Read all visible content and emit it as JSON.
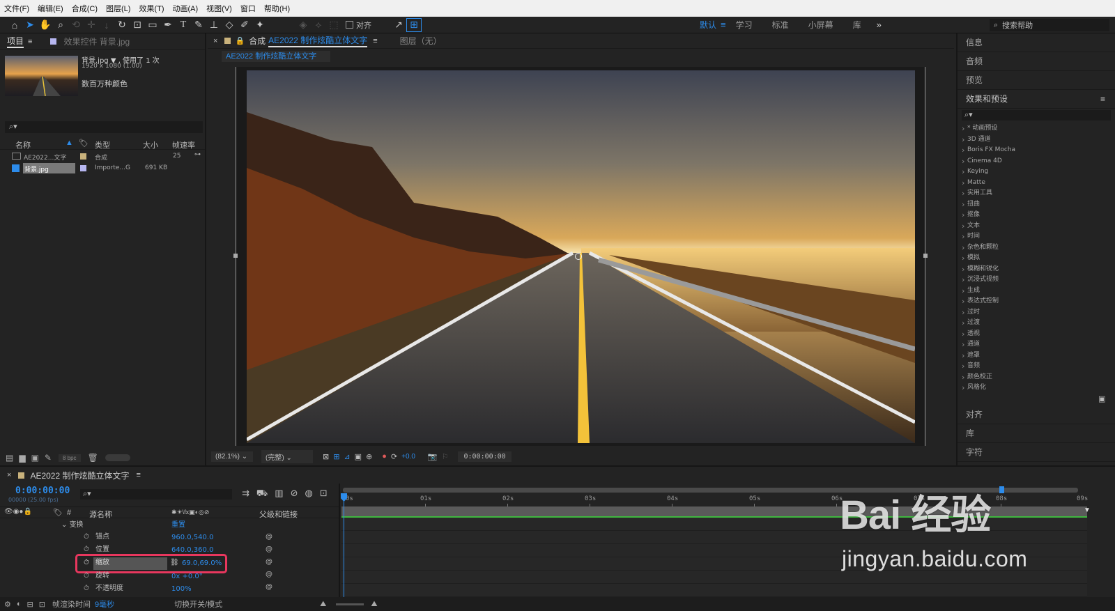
{
  "menu": [
    "文件(F)",
    "编辑(E)",
    "合成(C)",
    "图层(L)",
    "效果(T)",
    "动画(A)",
    "视图(V)",
    "窗口",
    "帮助(H)"
  ],
  "toolbar": {
    "align_label": "对齐",
    "workspaces": [
      "默认",
      "学习",
      "标准",
      "小屏幕",
      "库"
    ],
    "active_workspace": "默认",
    "search_placeholder": "搜索帮助"
  },
  "project": {
    "tab_project": "项目",
    "tab_effects": "效果控件 背景.jpg",
    "asset_name": "背景.jpg ▼ , 使用了 1 次",
    "asset_dims": "1920 x 1080 (1.00)",
    "asset_colors": "数百万种颜色",
    "columns": [
      "名称",
      "类型",
      "大小",
      "帧速率"
    ],
    "items": [
      {
        "name": "AE2022...文字",
        "type": "合成",
        "size": "",
        "fps": "25"
      },
      {
        "name": "背景.jpg",
        "type": "Importe...G",
        "size": "691 KB",
        "fps": ""
      }
    ],
    "bpc": "8 bpc"
  },
  "comp": {
    "tab_prefix": "合成",
    "comp_name": "AE2022 制作炫酷立体文字",
    "layer_tab": "图层（无）",
    "subtab": "AE2022 制作炫酷立体文字",
    "zoom": "(82.1%)",
    "resolution": "(完整)",
    "exposure": "+0.0",
    "timecode": "0:00:00:00"
  },
  "right_panel": {
    "sections_top": [
      "信息",
      "音频",
      "预览"
    ],
    "effects_title": "效果和预设",
    "effects": [
      "* 动画预设",
      "3D 通道",
      "Boris FX Mocha",
      "Cinema 4D",
      "Keying",
      "Matte",
      "实用工具",
      "扭曲",
      "抠像",
      "文本",
      "时间",
      "杂色和颗粒",
      "模拟",
      "模糊和锐化",
      "沉浸式视频",
      "生成",
      "表达式控制",
      "过时",
      "过渡",
      "透视",
      "通道",
      "遮罩",
      "音频",
      "颜色校正",
      "风格化"
    ],
    "sections_bottom": [
      "对齐",
      "库",
      "字符"
    ]
  },
  "timeline": {
    "comp_name": "AE2022 制作炫酷立体文字",
    "timecode": "0:00:00:00",
    "fps_note": "00000 (25.00 fps)",
    "col_source": "源名称",
    "col_parent": "父级和链接",
    "transform_label": "变换",
    "reset_label": "重置",
    "props": [
      {
        "name": "锚点",
        "value": "960.0,540.0"
      },
      {
        "name": "位置",
        "value": "640.0,360.0"
      },
      {
        "name": "缩放",
        "value": "69.0,69.0%"
      },
      {
        "name": "旋转",
        "value": "0x +0.0°"
      },
      {
        "name": "不透明度",
        "value": "100%"
      }
    ],
    "ruler": [
      "0s",
      "01s",
      "02s",
      "03s",
      "04s",
      "05s",
      "06s",
      "07s",
      "08s",
      "09s"
    ],
    "status_render_label": "帧渲染时间",
    "status_render_value": "9毫秒",
    "status_toggle": "切换开关/模式"
  },
  "watermark": {
    "text": "Bai 经验",
    "url": "jingyan.baidu.com"
  }
}
